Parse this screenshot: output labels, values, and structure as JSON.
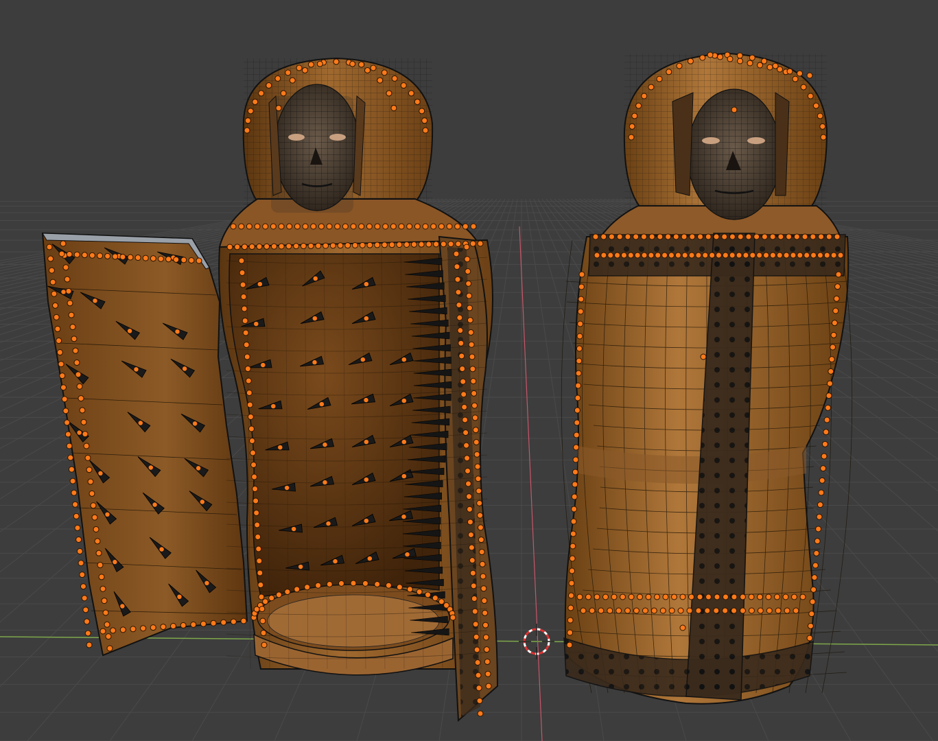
{
  "viewport": {
    "shading_mode": "solid-edit-mode",
    "background_color": "#3d3d3d",
    "grid_color": "#4a4a4a",
    "x_axis_color": "#c8566a",
    "y_axis_color": "#7ea84a",
    "selection_color": "#ff7a1a",
    "wire_color": "#111111"
  },
  "objects": [
    {
      "kind": "iron-maiden-open",
      "state": "open",
      "door": "left-door-panel",
      "material_color": "#8a5a2c",
      "inner_color": "#6b3f16"
    },
    {
      "kind": "iron-maiden-closed",
      "state": "closed",
      "material_color": "#9c6530"
    }
  ],
  "cursor": {
    "kind": "3d-cursor",
    "icon": "3d-cursor-icon"
  }
}
